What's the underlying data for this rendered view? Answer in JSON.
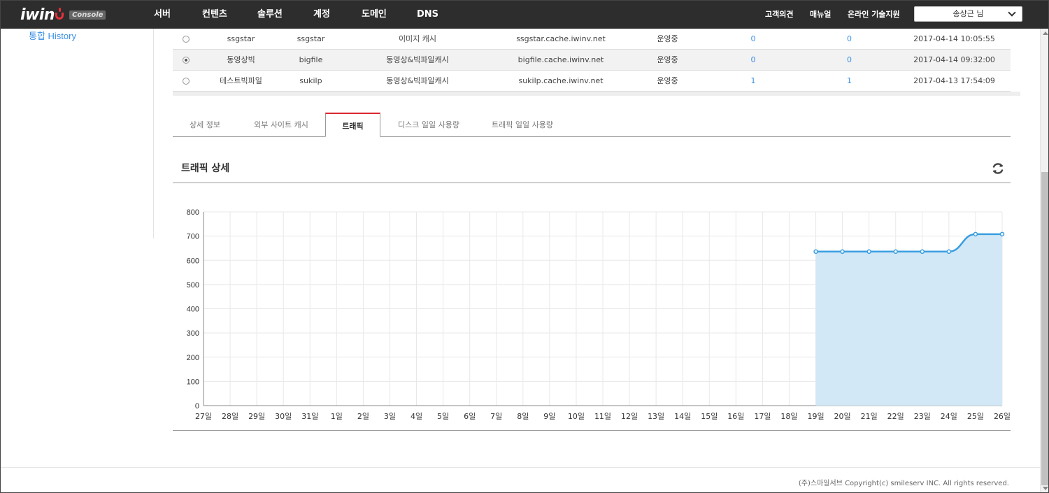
{
  "header": {
    "logo_text": "iwin",
    "logo_badge": "Console",
    "nav": [
      "서버",
      "컨텐츠",
      "솔루션",
      "계정",
      "도메인",
      "DNS"
    ],
    "util": [
      "고객의견",
      "매뉴얼",
      "온라인 기술지원"
    ],
    "user": "송상근 님"
  },
  "sidebar": {
    "link": "통합 History"
  },
  "table": {
    "rows": [
      {
        "name": "ssgstar",
        "id": "ssgstar",
        "type": "이미지 캐시",
        "domain": "ssgstar.cache.iwinv.net",
        "status": "운영중",
        "count1": "0",
        "count2": "0",
        "date": "2017-04-14 10:05:55",
        "selected": false
      },
      {
        "name": "동영상빅",
        "id": "bigfile",
        "type": "동영상&빅파일캐시",
        "domain": "bigfile.cache.iwinv.net",
        "status": "운영중",
        "count1": "0",
        "count2": "0",
        "date": "2017-04-14 09:32:00",
        "selected": true
      },
      {
        "name": "테스트빅파일",
        "id": "sukilp",
        "type": "동영상&빅파일캐시",
        "domain": "sukilp.cache.iwinv.net",
        "status": "운영중",
        "count1": "1",
        "count2": "1",
        "date": "2017-04-13 17:54:09",
        "selected": false
      }
    ]
  },
  "tabs": [
    "상세 정보",
    "외부 사이트 캐시",
    "트래픽",
    "디스크 일일 사용량",
    "트래픽 일일 사용량"
  ],
  "active_tab": "트래픽",
  "section_title": "트래픽 상세",
  "chart_data": {
    "type": "area",
    "categories": [
      "27일",
      "28일",
      "29일",
      "30일",
      "31일",
      "1일",
      "2일",
      "3일",
      "4일",
      "5일",
      "6일",
      "7일",
      "8일",
      "9일",
      "10일",
      "11일",
      "12일",
      "13일",
      "14일",
      "15일",
      "16일",
      "17일",
      "18일",
      "19일",
      "20일",
      "21일",
      "22일",
      "23일",
      "24일",
      "25일",
      "26일"
    ],
    "values": [
      null,
      null,
      null,
      null,
      null,
      null,
      null,
      null,
      null,
      null,
      null,
      null,
      null,
      null,
      null,
      null,
      null,
      null,
      null,
      null,
      null,
      null,
      null,
      636,
      636,
      636,
      636,
      636,
      636,
      708,
      708
    ],
    "ylim": [
      0,
      800
    ],
    "yticks": [
      0,
      100,
      200,
      300,
      400,
      500,
      600,
      700,
      800
    ],
    "grid": true,
    "line_color": "#3a9ee0",
    "fill_color": "#d2e8f7"
  },
  "footer": "(주)스마일서브 Copyright(c) smileserv INC. All rights reserved."
}
